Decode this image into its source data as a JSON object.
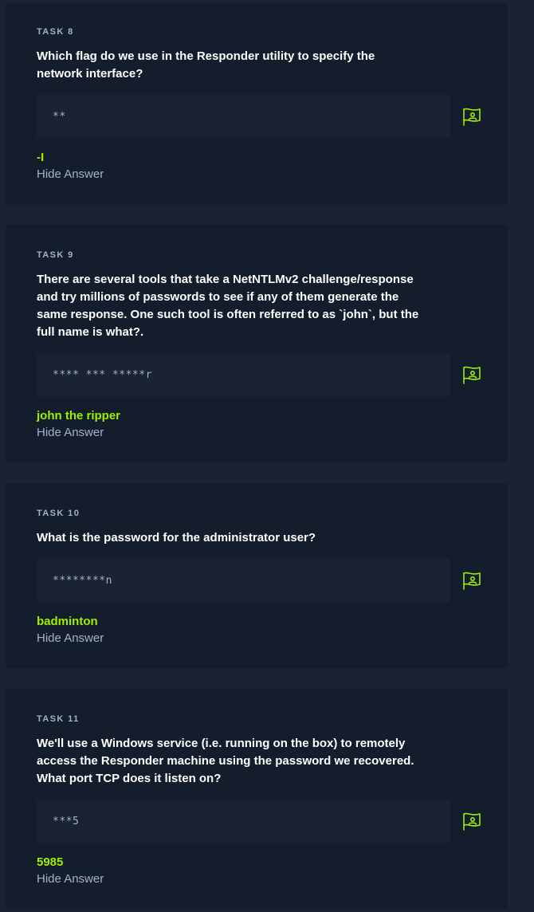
{
  "colors": {
    "page_background": "#1a2332",
    "card_background": "#141d2b",
    "accent_green": "#9fef00",
    "muted_text": "#a4b1cd"
  },
  "tasks": [
    {
      "label": "TASK 8",
      "question": "Which flag do we use in the Responder utility to specify the network interface?",
      "masked_hint": "**",
      "answer": "-I",
      "hide_label": "Hide Answer",
      "icon": "flag-submit-icon"
    },
    {
      "label": "TASK 9",
      "question": "There are several tools that take a NetNTLMv2 challenge/response and try millions of passwords to see if any of them generate the same response. One such tool is often referred to as `john`, but the full name is what?.",
      "masked_hint": "**** *** *****r",
      "answer": "john the ripper",
      "hide_label": "Hide Answer",
      "icon": "flag-submit-icon"
    },
    {
      "label": "TASK 10",
      "question": "What is the password for the administrator user?",
      "masked_hint": "********n",
      "answer": "badminton",
      "hide_label": "Hide Answer",
      "icon": "flag-submit-icon"
    },
    {
      "label": "TASK 11",
      "question": "We'll use a Windows service (i.e. running on the box) to remotely access the Responder machine using the password we recovered. What port TCP does it listen on?",
      "masked_hint": "***5",
      "answer": "5985",
      "hide_label": "Hide Answer",
      "icon": "flag-submit-icon"
    }
  ]
}
